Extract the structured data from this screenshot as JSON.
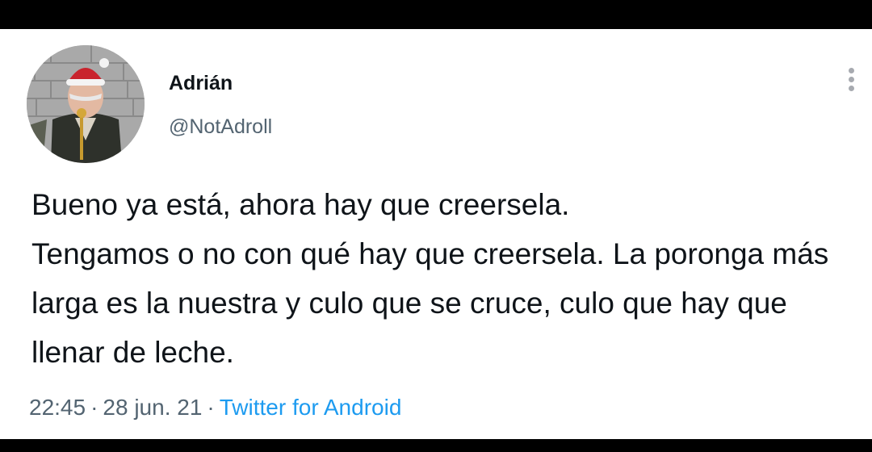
{
  "tweet": {
    "author": {
      "name": "Adrián",
      "handle": "@NotAdroll"
    },
    "more_icon": "more-vertical-icon",
    "text": "Bueno ya está, ahora hay que creersela.\nTengamos o no con qué hay que creersela. La poronga más larga es la nuestra y culo que se cruce, culo que hay que llenar de leche.",
    "time": "22:45",
    "separator": "·",
    "date": "28 jun. 21",
    "source": "Twitter for Android"
  },
  "colors": {
    "name": "#0f1419",
    "secondary": "#536471",
    "link": "#1d9bf0",
    "background": "#ffffff",
    "frame": "#000000"
  }
}
